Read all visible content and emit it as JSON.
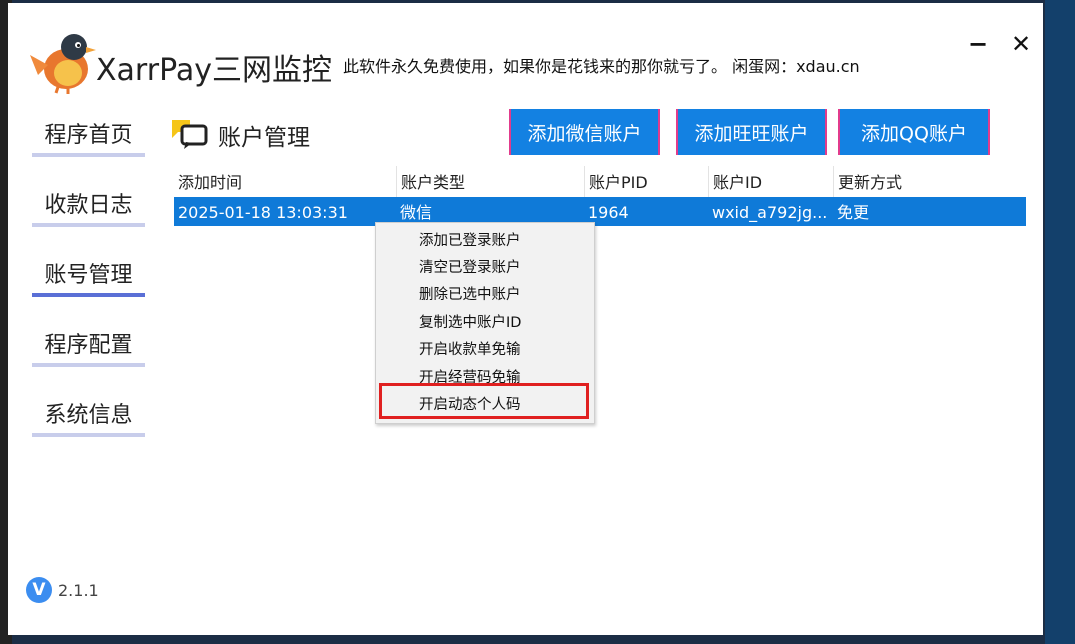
{
  "app": {
    "title": "XarrPay三网监控",
    "subtitle": "此软件永久免费使用，如果你是花钱来的那你就亏了。 闲蛋网：xdau.cn",
    "minimize_label": "−",
    "close_label": "✕",
    "logo_icon": "bird-logo-icon"
  },
  "sidebar": {
    "items": [
      {
        "label": "程序首页",
        "active": false
      },
      {
        "label": "收款日志",
        "active": false
      },
      {
        "label": "账号管理",
        "active": true
      },
      {
        "label": "程序配置",
        "active": false
      },
      {
        "label": "系统信息",
        "active": false
      }
    ]
  },
  "section": {
    "title": "账户管理",
    "icon": "chat-bubble-icon"
  },
  "buttons": {
    "add_wechat": "添加微信账户",
    "add_wangwang": "添加旺旺账户",
    "add_qq": "添加QQ账户"
  },
  "table": {
    "columns": [
      "添加时间",
      "账户类型",
      "账户PID",
      "账户ID",
      "更新方式"
    ],
    "rows": [
      [
        "2025-01-18 13:03:31",
        "微信",
        "1964",
        "wxid_a792jg...",
        "免更"
      ]
    ]
  },
  "context_menu": {
    "items": [
      "添加已登录账户",
      "清空已登录账户",
      "删除已选中账户",
      "复制选中账户ID",
      "开启收款单免输",
      "开启经营码免输",
      "开启动态个人码"
    ],
    "highlighted_index": 6
  },
  "version": {
    "icon_letter": "V",
    "number": "2.1.1"
  },
  "colors": {
    "accent": "#1381e2",
    "selected_row": "#0f7ad8",
    "highlight_box": "#e02020",
    "nav_active": "#5a6fd6"
  }
}
